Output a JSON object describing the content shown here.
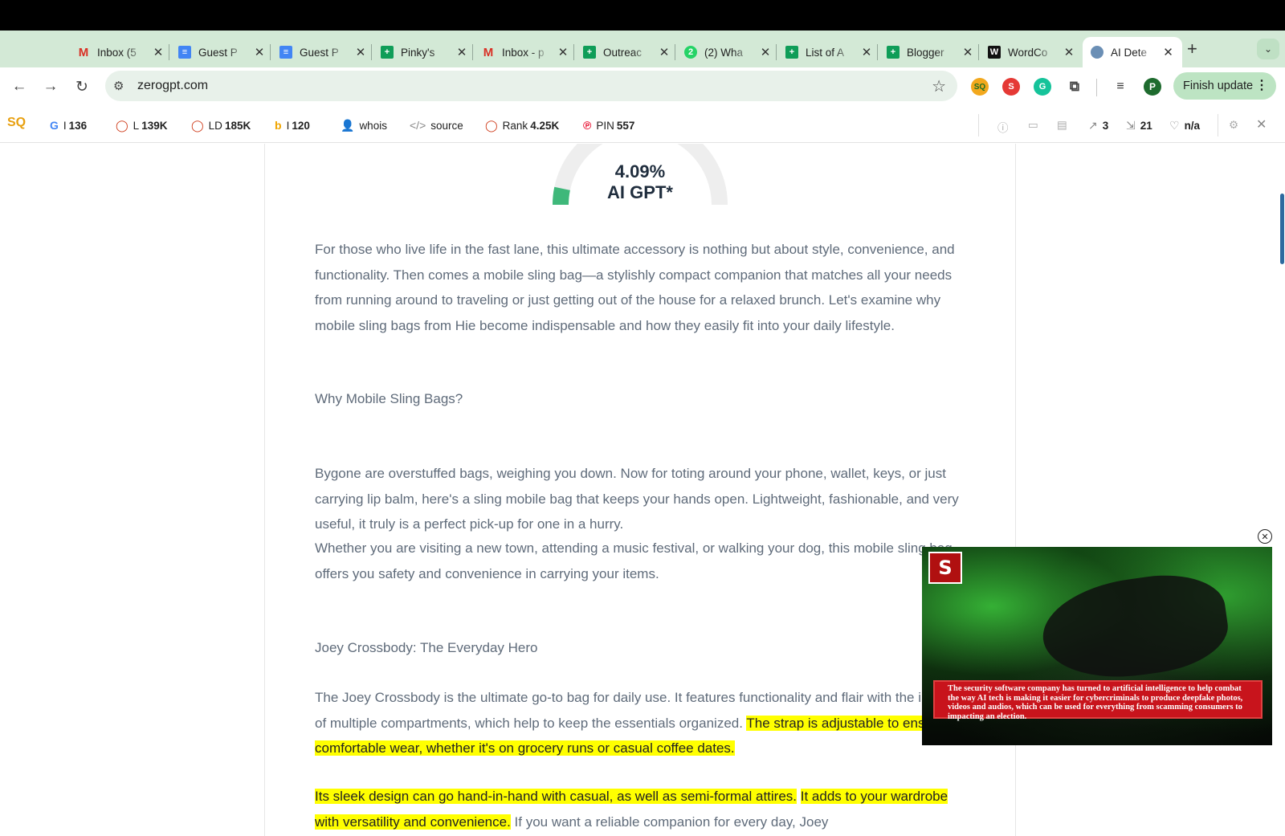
{
  "tabs": [
    {
      "title": "Inbox (5",
      "icon": "gmail-icon"
    },
    {
      "title": "Guest P",
      "icon": "google-docs-icon"
    },
    {
      "title": "Guest P",
      "icon": "google-docs-icon"
    },
    {
      "title": "Pinky's",
      "icon": "google-sheets-icon"
    },
    {
      "title": "Inbox - p",
      "icon": "gmail-icon"
    },
    {
      "title": "Outreac",
      "icon": "google-sheets-icon"
    },
    {
      "title": "(2) Wha",
      "icon": "whatsapp-icon"
    },
    {
      "title": "List of A",
      "icon": "google-sheets-icon"
    },
    {
      "title": "Blogger",
      "icon": "google-sheets-icon"
    },
    {
      "title": "WordCo",
      "icon": "wordcounter-icon"
    },
    {
      "title": "AI Dete",
      "icon": "globe-icon",
      "active": true
    }
  ],
  "toolbar": {
    "url": "zerogpt.com",
    "finish_update_label": "Finish update",
    "profile_initial": "P"
  },
  "seobar": {
    "items": [
      {
        "label": "I",
        "value": "136",
        "icon": "google-icon"
      },
      {
        "label": "L",
        "value": "139K",
        "icon": "circle-icon"
      },
      {
        "label": "LD",
        "value": "185K",
        "icon": "circle-icon"
      },
      {
        "label": "I",
        "value": "120",
        "icon": "bing-icon"
      },
      {
        "label": "whois",
        "value": "",
        "icon": "person-icon"
      },
      {
        "label": "source",
        "value": "",
        "icon": "code-icon"
      },
      {
        "label": "Rank",
        "value": "4.25K",
        "icon": "circle-icon"
      },
      {
        "label": "PIN",
        "value": "557",
        "icon": "pinterest-icon"
      }
    ],
    "right": {
      "external_links": "3",
      "internal_links": "21",
      "nofollow": "n/a"
    }
  },
  "result": {
    "percent": "4.09%",
    "label": "AI GPT*",
    "ai_fraction": 0.0409
  },
  "content": {
    "p1": "For those who live life in the fast lane, this ultimate accessory is nothing but about style, convenience, and functionality. Then comes a mobile sling bag—a stylishly compact companion that matches all your needs from running around to traveling or just getting out of the house for a relaxed brunch. Let's examine why mobile sling bags from Hie become indispensable and how they easily fit into your daily lifestyle.",
    "h1": "Why Mobile Sling Bags?",
    "p2": "Bygone are overstuffed bags, weighing you down. Now for toting around your phone, wallet, keys, or just carrying lip balm, here's a sling mobile bag that keeps your hands open. Lightweight, fashionable, and very useful, it truly is a perfect pick-up for one in a hurry.",
    "p3": "Whether you are visiting a new town, attending a music festival, or walking your dog, this mobile sling bag offers you safety and convenience in carrying your items.",
    "h2": "Joey Crossbody: The Everyday Hero",
    "p4_plain": "The Joey Crossbody is the ultimate go-to bag for daily use. It features functionality and flair with the inclusion of multiple compartments, which help to keep the essentials organized. ",
    "p4_hl": "The strap is adjustable to ensure comfortable wear, whether it's on grocery runs or casual coffee dates.",
    "p5_hl1": "Its sleek design can go hand-in-hand with casual, as well as semi-formal attires.",
    "p5_hl2": "It adds to your wardrobe with versatility and convenience.",
    "p5_plain": " If you want a reliable companion for every day, Joey"
  },
  "video": {
    "logo": "S",
    "caption": "The security software company has turned to artificial intelligence to help combat the way AI tech is making it easier for cybercriminals to produce deepfake photos, videos and audios, which can be used for everything from scamming consumers to impacting an election."
  }
}
